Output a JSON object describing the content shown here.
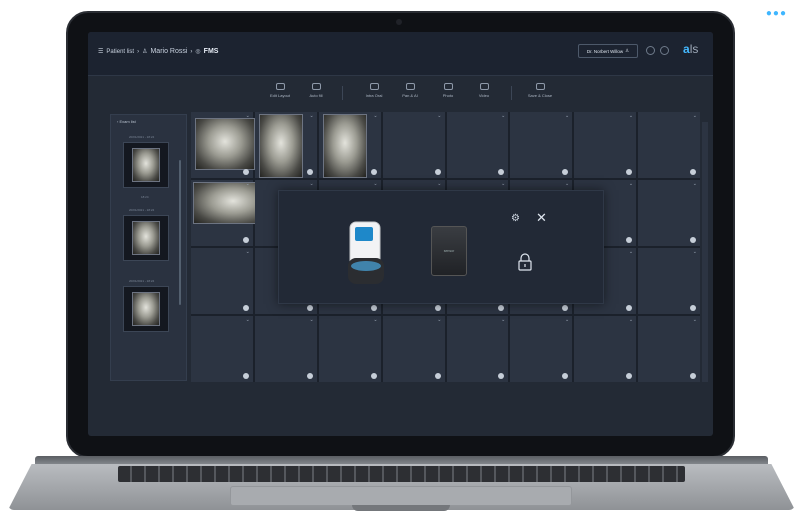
{
  "header": {
    "patient_list": "Patient list",
    "patient_name": "Mario Rossi",
    "exam_type": "FMS",
    "doctor": "Dr. Norbert Willow",
    "logo_main": "a",
    "logo_rest": "ls"
  },
  "toolbar": {
    "items": [
      {
        "label": "Edit Layout",
        "icon": "layout-icon"
      },
      {
        "label": "Auto fill",
        "icon": "autofill-icon"
      },
      {
        "label": "Intra Oral",
        "icon": "tooth-icon"
      },
      {
        "label": "Pan & AI",
        "icon": "panoramic-icon"
      },
      {
        "label": "Photo",
        "icon": "camera-icon"
      },
      {
        "label": "Video",
        "icon": "video-icon"
      },
      {
        "label": "Save & Close",
        "icon": "save-icon"
      }
    ]
  },
  "left_panel": {
    "title": "Exam list",
    "captions": [
      "20/01/2021 - 18:24",
      "18:24",
      "20/01/2021 - 18:24",
      "20/01/2021 - 18:24"
    ]
  },
  "modal": {
    "sensor_label": "sensor"
  }
}
